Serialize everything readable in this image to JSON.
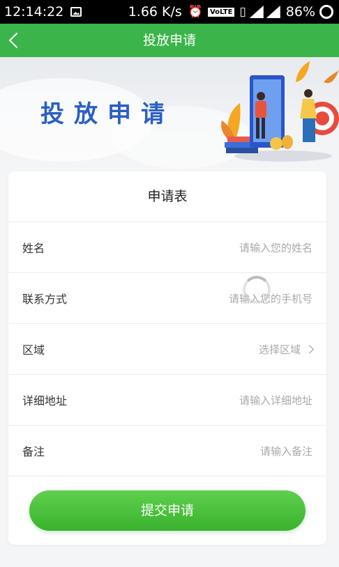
{
  "status_bar": {
    "time": "12:14:22",
    "speed": "1.66 K/s",
    "volte": "VoLTE",
    "battery": "86%"
  },
  "navbar": {
    "title": "投放申请"
  },
  "banner": {
    "title": "投放申请"
  },
  "form": {
    "title": "申请表",
    "fields": [
      {
        "label": "姓名",
        "placeholder": "请输入您的姓名"
      },
      {
        "label": "联系方式",
        "placeholder": "请输入您的手机号"
      },
      {
        "label": "区域",
        "placeholder": "选择区域"
      },
      {
        "label": "详细地址",
        "placeholder": "请输入详细地址"
      },
      {
        "label": "备注",
        "placeholder": "请输入备注"
      }
    ],
    "submit_label": "提交申请"
  },
  "colors": {
    "primary": "#3bb54a",
    "banner_title": "#2a5fc4"
  }
}
